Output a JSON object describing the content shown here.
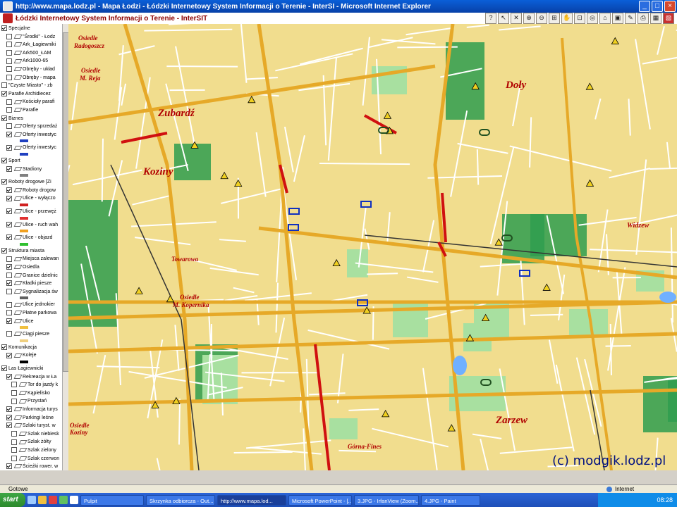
{
  "window": {
    "title": "http://www.mapa.lodz.pl - Mapa Łodzi - Łódzki Internetowy System Informacji o Terenie - InterSI - Microsoft Internet Explorer",
    "min": "_",
    "max": "□",
    "close": "×"
  },
  "app": {
    "title": "Łódzki Internetowy System Informacji o Terenie - InterSIT",
    "tools": [
      "?",
      "↖",
      "✕",
      "⊕",
      "⊖",
      "⊞",
      "✋",
      "⊡",
      "◎",
      "⌂",
      "▣",
      "✎",
      "⎙",
      "▦",
      "▧"
    ]
  },
  "sidebar": {
    "items": [
      {
        "label": "Specjalne",
        "level": 0,
        "checked": true
      },
      {
        "label": "\"Środki\" - Łodz",
        "level": 1,
        "checked": false
      },
      {
        "label": "Ark_Łagiewniki",
        "level": 1,
        "checked": false
      },
      {
        "label": "Ark500_ŁAM",
        "level": 1,
        "checked": false
      },
      {
        "label": "Ark1000-65",
        "level": 1,
        "checked": false
      },
      {
        "label": "Obręby - układ",
        "level": 1,
        "checked": false
      },
      {
        "label": "Obręby - mapa",
        "level": 1,
        "checked": false
      },
      {
        "label": "\"Czyste Miasto\" - zb",
        "level": 0,
        "checked": false
      },
      {
        "label": "Parafie Archidiecez",
        "level": 0,
        "checked": true
      },
      {
        "label": "Kościoły parafi",
        "level": 1,
        "checked": false
      },
      {
        "label": "Parafie",
        "level": 1,
        "checked": false
      },
      {
        "label": "Biznes",
        "level": 0,
        "checked": true
      },
      {
        "label": "Oferty sprzedaż",
        "level": 1,
        "checked": false
      },
      {
        "label": "Oferty inwestyc",
        "level": 1,
        "checked": true
      },
      {
        "label": "Oferty inwestyc",
        "level": 1,
        "checked": true
      },
      {
        "label": "Sport",
        "level": 0,
        "checked": true
      },
      {
        "label": "Stadiony",
        "level": 1,
        "checked": true
      },
      {
        "label": "Roboty drogowe [Zi",
        "level": 0,
        "checked": true
      },
      {
        "label": "Roboty drogow",
        "level": 1,
        "checked": true
      },
      {
        "label": "Ulice - wyłączo",
        "level": 1,
        "checked": true
      },
      {
        "label": "Ulice - przewęż",
        "level": 1,
        "checked": true
      },
      {
        "label": "Ulice - ruch wah",
        "level": 1,
        "checked": true
      },
      {
        "label": "Ulice - objazd",
        "level": 1,
        "checked": true
      },
      {
        "label": "Struktura miasta",
        "level": 0,
        "checked": true
      },
      {
        "label": "Miejsca zalewan",
        "level": 1,
        "checked": false
      },
      {
        "label": "Osiedla",
        "level": 1,
        "checked": true
      },
      {
        "label": "Granice dzielnic",
        "level": 1,
        "checked": false
      },
      {
        "label": "Kładki piesze",
        "level": 1,
        "checked": true
      },
      {
        "label": "Sygnalizacja św",
        "level": 1,
        "checked": false
      },
      {
        "label": "Ulice jednokier",
        "level": 1,
        "checked": false
      },
      {
        "label": "Płatne parkowa",
        "level": 1,
        "checked": false
      },
      {
        "label": "Ulice",
        "level": 1,
        "checked": true
      },
      {
        "label": "Ciągi piesze",
        "level": 1,
        "checked": false
      },
      {
        "label": "Komunikacja",
        "level": 0,
        "checked": true
      },
      {
        "label": "Koleje",
        "level": 1,
        "checked": true
      },
      {
        "label": "Las Łagiewnicki",
        "level": 0,
        "checked": true
      },
      {
        "label": "Rekreacja w Ła",
        "level": 1,
        "checked": true
      },
      {
        "label": "Tor do jazdy k",
        "level": 2,
        "checked": false
      },
      {
        "label": "Kąpielisko",
        "level": 2,
        "checked": false
      },
      {
        "label": "Przystań",
        "level": 2,
        "checked": false
      },
      {
        "label": "Informacja turys",
        "level": 1,
        "checked": true
      },
      {
        "label": "Parkingi leśne",
        "level": 1,
        "checked": true
      },
      {
        "label": "Szlaki turyst. w",
        "level": 1,
        "checked": true
      },
      {
        "label": "Szlak niebiesk",
        "level": 2,
        "checked": false
      },
      {
        "label": "Szlak żółty",
        "level": 2,
        "checked": false
      },
      {
        "label": "Szlak zielony",
        "level": 2,
        "checked": false
      },
      {
        "label": "Szlak czerwon",
        "level": 2,
        "checked": false
      },
      {
        "label": "Ścieżki rower. w",
        "level": 1,
        "checked": true
      }
    ]
  },
  "map": {
    "labels": [
      {
        "text": "Osiedle",
        "size": 9
      },
      {
        "text": "Radogoszcz",
        "size": 9
      },
      {
        "text": "Osiedle",
        "size": 9
      },
      {
        "text": "M. Reja",
        "size": 9
      },
      {
        "text": "Doły",
        "size": 15
      },
      {
        "text": "Zubardź",
        "size": 15
      },
      {
        "text": "Koziny",
        "size": 15
      },
      {
        "text": "Widzew",
        "size": 10
      },
      {
        "text": "Towarowa",
        "size": 9
      },
      {
        "text": "Osiedle",
        "size": 9
      },
      {
        "text": "M. Kopernika",
        "size": 9
      },
      {
        "text": "Zarzew",
        "size": 15
      },
      {
        "text": "Osiedle",
        "size": 9
      },
      {
        "text": "Koziny",
        "size": 9
      },
      {
        "text": "Górna-Fines",
        "size": 9
      }
    ],
    "copyright": "(c) modgik.lodz.pl",
    "colors": {
      "background": "#f1dd8e",
      "street": "#ffffff",
      "main_road": "#e6a928",
      "park": "#2f9d4f",
      "closure": "#d01010"
    }
  },
  "status": {
    "left": "Gotowe",
    "zone": "Internet"
  },
  "taskbar": {
    "start": "start",
    "tasks": [
      "Pulpit",
      "Skrzynka odbiorcza - Out...",
      "http://www.mapa.lod...",
      "Microsoft PowerPoint - [...",
      "3.JPG - IrfanView (Zoom...",
      "4.JPG - Paint"
    ],
    "clock": "08:28"
  }
}
